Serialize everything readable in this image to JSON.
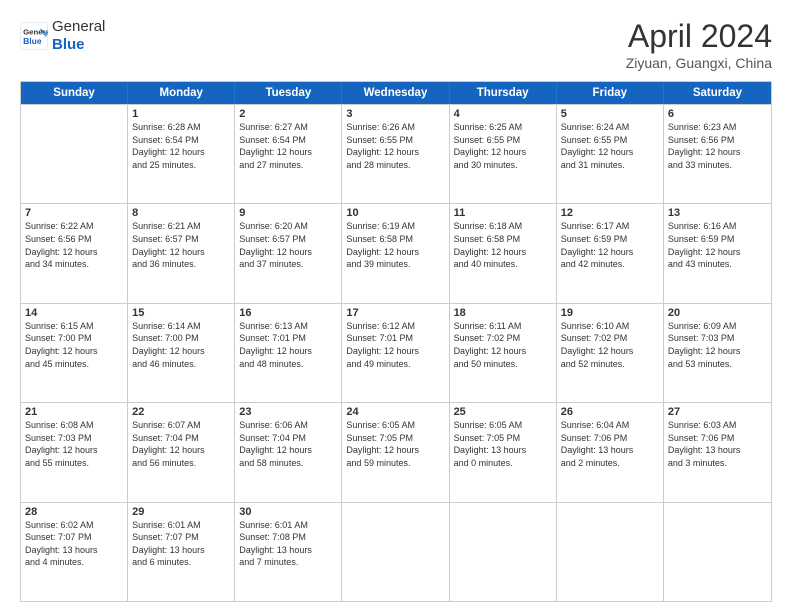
{
  "header": {
    "logo_line1": "General",
    "logo_line2": "Blue",
    "month": "April 2024",
    "location": "Ziyuan, Guangxi, China"
  },
  "weekdays": [
    "Sunday",
    "Monday",
    "Tuesday",
    "Wednesday",
    "Thursday",
    "Friday",
    "Saturday"
  ],
  "rows": [
    [
      {
        "day": "",
        "lines": []
      },
      {
        "day": "1",
        "lines": [
          "Sunrise: 6:28 AM",
          "Sunset: 6:54 PM",
          "Daylight: 12 hours",
          "and 25 minutes."
        ]
      },
      {
        "day": "2",
        "lines": [
          "Sunrise: 6:27 AM",
          "Sunset: 6:54 PM",
          "Daylight: 12 hours",
          "and 27 minutes."
        ]
      },
      {
        "day": "3",
        "lines": [
          "Sunrise: 6:26 AM",
          "Sunset: 6:55 PM",
          "Daylight: 12 hours",
          "and 28 minutes."
        ]
      },
      {
        "day": "4",
        "lines": [
          "Sunrise: 6:25 AM",
          "Sunset: 6:55 PM",
          "Daylight: 12 hours",
          "and 30 minutes."
        ]
      },
      {
        "day": "5",
        "lines": [
          "Sunrise: 6:24 AM",
          "Sunset: 6:55 PM",
          "Daylight: 12 hours",
          "and 31 minutes."
        ]
      },
      {
        "day": "6",
        "lines": [
          "Sunrise: 6:23 AM",
          "Sunset: 6:56 PM",
          "Daylight: 12 hours",
          "and 33 minutes."
        ]
      }
    ],
    [
      {
        "day": "7",
        "lines": [
          "Sunrise: 6:22 AM",
          "Sunset: 6:56 PM",
          "Daylight: 12 hours",
          "and 34 minutes."
        ]
      },
      {
        "day": "8",
        "lines": [
          "Sunrise: 6:21 AM",
          "Sunset: 6:57 PM",
          "Daylight: 12 hours",
          "and 36 minutes."
        ]
      },
      {
        "day": "9",
        "lines": [
          "Sunrise: 6:20 AM",
          "Sunset: 6:57 PM",
          "Daylight: 12 hours",
          "and 37 minutes."
        ]
      },
      {
        "day": "10",
        "lines": [
          "Sunrise: 6:19 AM",
          "Sunset: 6:58 PM",
          "Daylight: 12 hours",
          "and 39 minutes."
        ]
      },
      {
        "day": "11",
        "lines": [
          "Sunrise: 6:18 AM",
          "Sunset: 6:58 PM",
          "Daylight: 12 hours",
          "and 40 minutes."
        ]
      },
      {
        "day": "12",
        "lines": [
          "Sunrise: 6:17 AM",
          "Sunset: 6:59 PM",
          "Daylight: 12 hours",
          "and 42 minutes."
        ]
      },
      {
        "day": "13",
        "lines": [
          "Sunrise: 6:16 AM",
          "Sunset: 6:59 PM",
          "Daylight: 12 hours",
          "and 43 minutes."
        ]
      }
    ],
    [
      {
        "day": "14",
        "lines": [
          "Sunrise: 6:15 AM",
          "Sunset: 7:00 PM",
          "Daylight: 12 hours",
          "and 45 minutes."
        ]
      },
      {
        "day": "15",
        "lines": [
          "Sunrise: 6:14 AM",
          "Sunset: 7:00 PM",
          "Daylight: 12 hours",
          "and 46 minutes."
        ]
      },
      {
        "day": "16",
        "lines": [
          "Sunrise: 6:13 AM",
          "Sunset: 7:01 PM",
          "Daylight: 12 hours",
          "and 48 minutes."
        ]
      },
      {
        "day": "17",
        "lines": [
          "Sunrise: 6:12 AM",
          "Sunset: 7:01 PM",
          "Daylight: 12 hours",
          "and 49 minutes."
        ]
      },
      {
        "day": "18",
        "lines": [
          "Sunrise: 6:11 AM",
          "Sunset: 7:02 PM",
          "Daylight: 12 hours",
          "and 50 minutes."
        ]
      },
      {
        "day": "19",
        "lines": [
          "Sunrise: 6:10 AM",
          "Sunset: 7:02 PM",
          "Daylight: 12 hours",
          "and 52 minutes."
        ]
      },
      {
        "day": "20",
        "lines": [
          "Sunrise: 6:09 AM",
          "Sunset: 7:03 PM",
          "Daylight: 12 hours",
          "and 53 minutes."
        ]
      }
    ],
    [
      {
        "day": "21",
        "lines": [
          "Sunrise: 6:08 AM",
          "Sunset: 7:03 PM",
          "Daylight: 12 hours",
          "and 55 minutes."
        ]
      },
      {
        "day": "22",
        "lines": [
          "Sunrise: 6:07 AM",
          "Sunset: 7:04 PM",
          "Daylight: 12 hours",
          "and 56 minutes."
        ]
      },
      {
        "day": "23",
        "lines": [
          "Sunrise: 6:06 AM",
          "Sunset: 7:04 PM",
          "Daylight: 12 hours",
          "and 58 minutes."
        ]
      },
      {
        "day": "24",
        "lines": [
          "Sunrise: 6:05 AM",
          "Sunset: 7:05 PM",
          "Daylight: 12 hours",
          "and 59 minutes."
        ]
      },
      {
        "day": "25",
        "lines": [
          "Sunrise: 6:05 AM",
          "Sunset: 7:05 PM",
          "Daylight: 13 hours",
          "and 0 minutes."
        ]
      },
      {
        "day": "26",
        "lines": [
          "Sunrise: 6:04 AM",
          "Sunset: 7:06 PM",
          "Daylight: 13 hours",
          "and 2 minutes."
        ]
      },
      {
        "day": "27",
        "lines": [
          "Sunrise: 6:03 AM",
          "Sunset: 7:06 PM",
          "Daylight: 13 hours",
          "and 3 minutes."
        ]
      }
    ],
    [
      {
        "day": "28",
        "lines": [
          "Sunrise: 6:02 AM",
          "Sunset: 7:07 PM",
          "Daylight: 13 hours",
          "and 4 minutes."
        ]
      },
      {
        "day": "29",
        "lines": [
          "Sunrise: 6:01 AM",
          "Sunset: 7:07 PM",
          "Daylight: 13 hours",
          "and 6 minutes."
        ]
      },
      {
        "day": "30",
        "lines": [
          "Sunrise: 6:01 AM",
          "Sunset: 7:08 PM",
          "Daylight: 13 hours",
          "and 7 minutes."
        ]
      },
      {
        "day": "",
        "lines": []
      },
      {
        "day": "",
        "lines": []
      },
      {
        "day": "",
        "lines": []
      },
      {
        "day": "",
        "lines": []
      }
    ]
  ]
}
